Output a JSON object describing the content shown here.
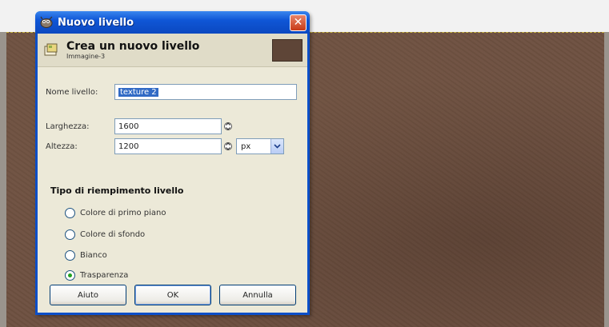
{
  "dialog": {
    "title": "Nuovo livello",
    "close_symbol": "✕",
    "header_title": "Crea un nuovo livello",
    "header_subtitle": "Immagine-3"
  },
  "fields": {
    "name_label": "Nome livello:",
    "name_value": "texture 2",
    "width_label": "Larghezza:",
    "width_value": "1600",
    "height_label": "Altezza:",
    "height_value": "1200",
    "unit_value": "px"
  },
  "fill": {
    "section_title": "Tipo di riempimento livello",
    "options": [
      {
        "label": "Colore di primo piano",
        "selected": false
      },
      {
        "label": "Colore di sfondo",
        "selected": false
      },
      {
        "label": "Bianco",
        "selected": false
      },
      {
        "label": "Trasparenza",
        "selected": true
      }
    ]
  },
  "buttons": {
    "help": "Aiuto",
    "ok": "OK",
    "cancel": "Annulla"
  },
  "colors": {
    "titlebar": "#0f56d6",
    "canvas": "#6e5141",
    "selection": "#316ac5"
  },
  "icons": {
    "title": "gimp-wilber-icon",
    "header": "new-layer-icon",
    "close": "close-icon",
    "spin": "spin-arrows-icon",
    "dropdown": "chevron-down-icon",
    "radio": "radio-icon"
  }
}
